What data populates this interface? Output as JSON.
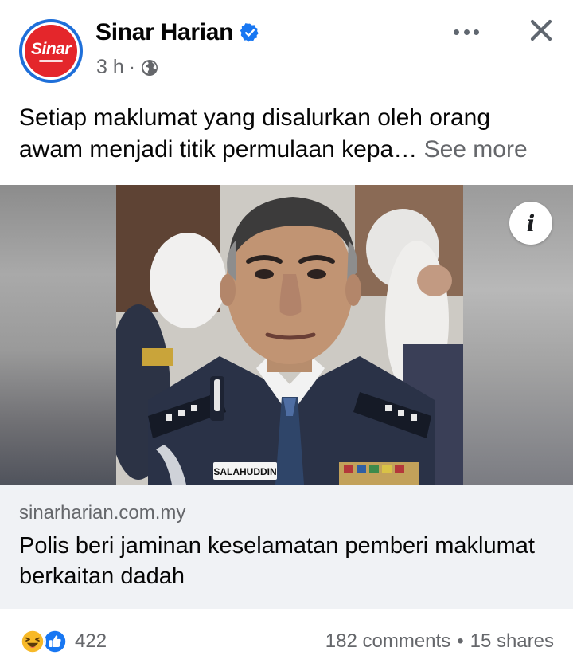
{
  "post": {
    "page_name": "Sinar Harian",
    "avatar_text": "Sinar",
    "time": "3 h",
    "separator": "·",
    "text": "Setiap maklumat yang disalurkan oleh orang awam menjadi titik permulaan kepa…",
    "see_more": "See more"
  },
  "media": {
    "nametag": "SALAHUDDIN",
    "info_label": "i"
  },
  "link": {
    "domain": "sinarharian.com.my",
    "title": "Polis beri jaminan keselamatan pemberi maklumat berkaitan dadah"
  },
  "footer": {
    "reaction_count": "422",
    "comments": "182 comments",
    "dot": "•",
    "shares": "15 shares",
    "reaction_icons": [
      "haha-icon",
      "like-icon"
    ]
  },
  "colors": {
    "brand_red": "#e4262b",
    "verified_blue": "#1877f2",
    "like_blue": "#1877f2",
    "haha_yellow": "#f7b928"
  }
}
